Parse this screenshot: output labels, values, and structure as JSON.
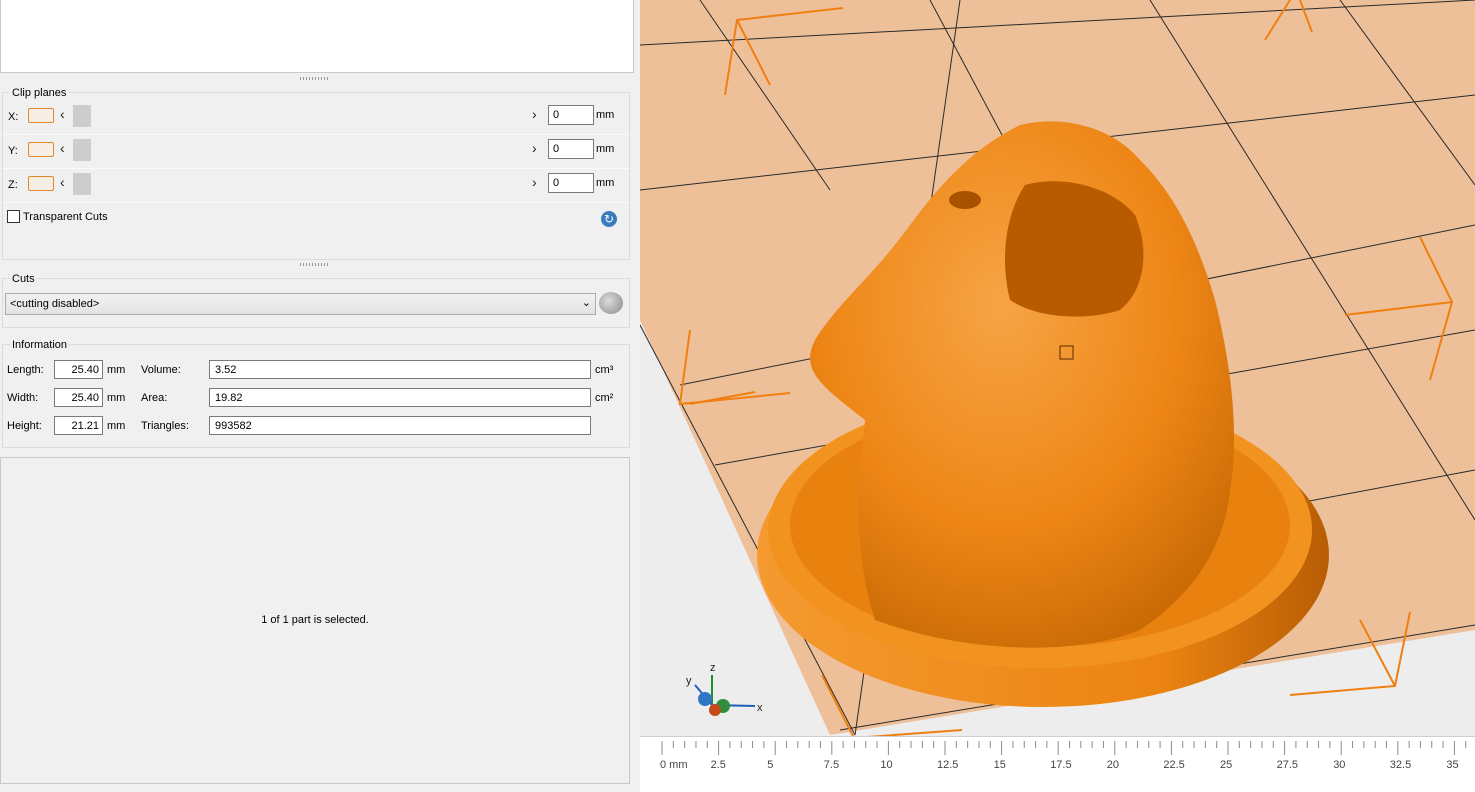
{
  "clip_planes": {
    "title": "Clip planes",
    "rows": [
      {
        "axis": "X:",
        "value": "0",
        "unit": "mm"
      },
      {
        "axis": "Y:",
        "value": "0",
        "unit": "mm"
      },
      {
        "axis": "Z:",
        "value": "0",
        "unit": "mm"
      }
    ],
    "arrow_left": "‹",
    "arrow_right": "›",
    "transparent_cuts_label": "Transparent Cuts",
    "transparent_cuts_checked": false,
    "reset_icon": "reset-icon"
  },
  "cuts": {
    "title": "Cuts",
    "selected": "<cutting disabled>"
  },
  "information": {
    "title": "Information",
    "length_label": "Length:",
    "length_value": "25.40",
    "length_unit": "mm",
    "width_label": "Width:",
    "width_value": "25.40",
    "width_unit": "mm",
    "height_label": "Height:",
    "height_value": "21.21",
    "height_unit": "mm",
    "volume_label": "Volume:",
    "volume_value": "3.52",
    "volume_unit": "cm³",
    "area_label": "Area:",
    "area_value": "19.82",
    "area_unit": "cm²",
    "triangles_label": "Triangles:",
    "triangles_value": "993582"
  },
  "status": "1 of 1 part is selected.",
  "viewport": {
    "model_color": "#f08a14",
    "bed_color": "#eec09a",
    "axes": {
      "x": "x",
      "y": "y",
      "z": "z"
    }
  },
  "ruler": {
    "labels": [
      "0 mm",
      "2.5",
      "5",
      "7.5",
      "10",
      "12.5",
      "15",
      "17.5",
      "20",
      "22.5",
      "25",
      "27.5",
      "30",
      "32.5",
      "35"
    ]
  }
}
